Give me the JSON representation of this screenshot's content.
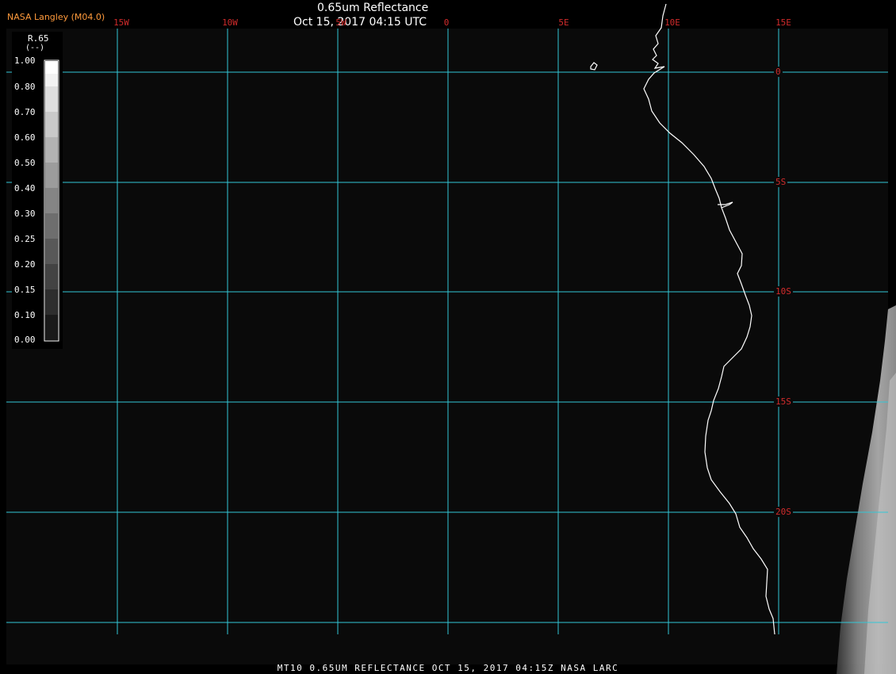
{
  "header": {
    "organization": "NASA Langley (M04.0)",
    "title": "0.65um Reflectance",
    "timestamp": "Oct 15, 2017 04:15 UTC"
  },
  "grid": {
    "longitude_labels": [
      "15W",
      "10W",
      "5W",
      "0",
      "5E",
      "10E",
      "15E"
    ],
    "latitude_labels": [
      "0",
      "5S",
      "10S",
      "15S",
      "20S"
    ],
    "gridline_color": "#33c7d6",
    "label_color": "#d12b2b"
  },
  "legend": {
    "variable": "R.65",
    "unit": "(--)",
    "ticks": [
      "1.00",
      "0.80",
      "0.70",
      "0.60",
      "0.50",
      "0.40",
      "0.30",
      "0.25",
      "0.20",
      "0.15",
      "0.10",
      "0.00"
    ]
  },
  "map": {
    "background_color": "#0a0a0a",
    "coastline_color": "#ffffff"
  },
  "footer": {
    "caption": "MT10  0.65UM REFLECTANCE   OCT 15, 2017 04:15Z   NASA LARC"
  }
}
